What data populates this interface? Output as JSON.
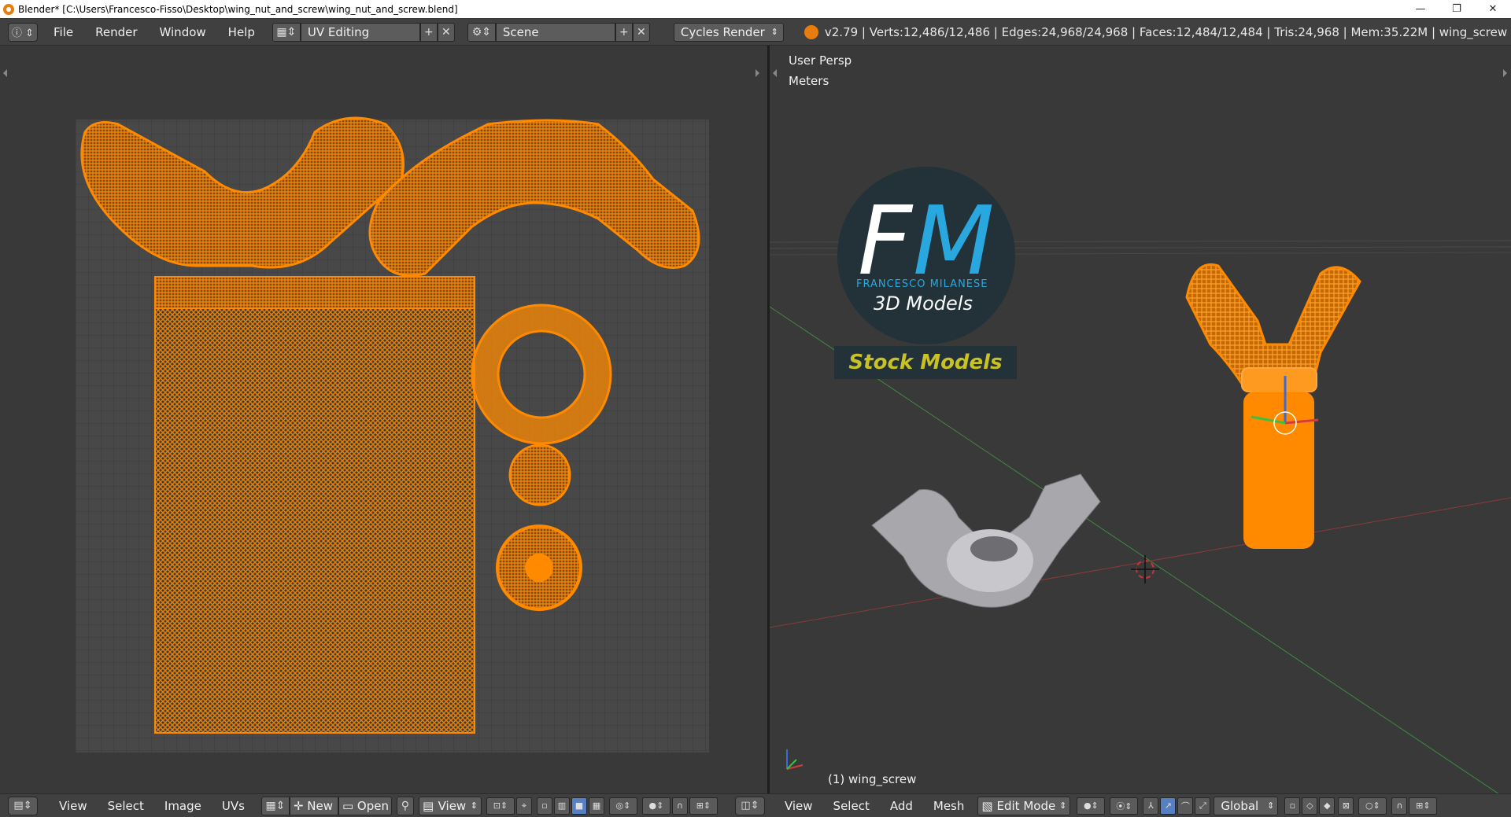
{
  "window": {
    "title": "Blender* [C:\\Users\\Francesco-Fisso\\Desktop\\wing_nut_and_screw\\wing_nut_and_screw.blend]",
    "minimize": "—",
    "maximize": "❐",
    "close": "✕"
  },
  "info_header": {
    "menus": [
      "File",
      "Render",
      "Window",
      "Help"
    ],
    "screen_layout": "UV Editing",
    "scene": "Scene",
    "render_engine": "Cycles Render",
    "stats": "v2.79 | Verts:12,486/12,486 | Edges:24,968/24,968 | Faces:12,484/12,484 | Tris:24,968 | Mem:35.22M | wing_screw"
  },
  "viewport": {
    "view_name": "User Persp",
    "units": "Meters",
    "object_label": "(1) wing_screw"
  },
  "logo": {
    "letter_f": "F",
    "letter_m": "M",
    "subtitle": "FRANCESCO MILANESE",
    "tagline": "3D Models",
    "badge": "Stock Models"
  },
  "uv_header": {
    "menus": [
      "View",
      "Select",
      "Image",
      "UVs"
    ],
    "new_label": "New",
    "open_label": "Open",
    "view_label": "View"
  },
  "view3d_header": {
    "menus": [
      "View",
      "Select",
      "Add",
      "Mesh"
    ],
    "mode": "Edit Mode",
    "orientation": "Global"
  },
  "colors": {
    "accent_orange": "#ff8a00",
    "blender_blue": "#29a8e0",
    "stock_yellow": "#c8c226"
  }
}
